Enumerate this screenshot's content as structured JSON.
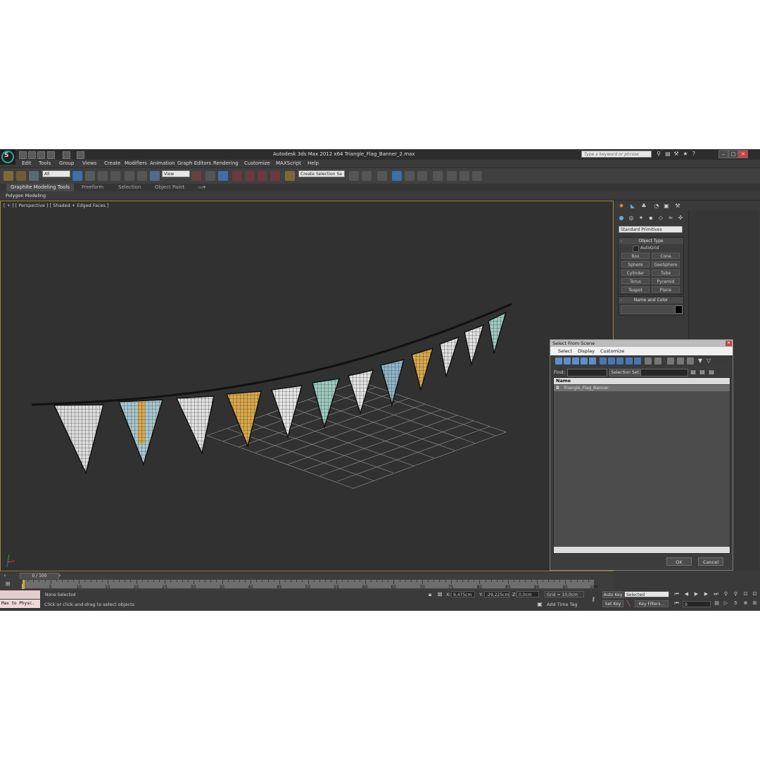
{
  "window": {
    "title": "Autodesk 3ds Max  2012 x64      Triangle_Flag_Banner_2.max",
    "search_placeholder": "Type a keyword or phrase"
  },
  "menu": [
    "Edit",
    "Tools",
    "Group",
    "Views",
    "Create",
    "Modifiers",
    "Animation",
    "Graph Editors",
    "Rendering",
    "Customize",
    "MAXScript",
    "Help"
  ],
  "toolbar": {
    "filter_value": "All",
    "ref_coord_value": "View",
    "named_selection_value": "Create Selection Se"
  },
  "ribbon": {
    "tabs": [
      "Graphite Modeling Tools",
      "Freeform",
      "Selection",
      "Object Paint"
    ],
    "subtab": "Polygon Modeling"
  },
  "viewport": {
    "label": "[ + ] [ Perspective ] [ Shaded + Edged Faces ]"
  },
  "command_panel": {
    "category": "Standard Primitives",
    "object_type_title": "Object Type",
    "autogrid_label": "AutoGrid",
    "primitives": [
      "Box",
      "Cone",
      "Sphere",
      "GeoSphere",
      "Cylinder",
      "Tube",
      "Torus",
      "Pyramid",
      "Teapot",
      "Plane"
    ],
    "name_color_title": "Name and Color"
  },
  "dialog": {
    "title": "Select From Scene",
    "menu": [
      "Select",
      "Display",
      "Customize"
    ],
    "find_label": "Find:",
    "selection_set_label": "Selection Set:",
    "column_name": "Name",
    "objects": [
      "Triangle_Flag_Banner"
    ],
    "ok_label": "OK",
    "cancel_label": "Cancel"
  },
  "timeline": {
    "frame_display": "0 / 100",
    "ticks": [
      "5",
      "10",
      "15",
      "20",
      "25",
      "30",
      "35",
      "40",
      "45",
      "50",
      "55",
      "60",
      "65",
      "70",
      "75",
      "80",
      "85",
      "90",
      "95",
      "100"
    ]
  },
  "status": {
    "maxscript_text": "Max to Physc.",
    "selection": "None Selected",
    "prompt": "Click or click-and-drag to select objects",
    "x_label": "X:",
    "x_value": "9,475cm",
    "y_label": "Y:",
    "y_value": "-29,225cm",
    "z_label": "Z:",
    "z_value": "0,0cm",
    "grid": "Grid = 10,0cm",
    "add_time_tag": "Add Time Tag",
    "auto_key": "Auto Key",
    "set_key": "Set Key",
    "selected_value": "Selected",
    "key_filters": "Key Filters...",
    "frame_value": "0"
  },
  "colors": {
    "flag_orange": "#d9a94a",
    "flag_blue": "#8fb5c8",
    "flag_teal": "#9ccbc0",
    "flag_white": "#e6e6e6",
    "viewport_bg": "#313131",
    "active_border": "#a38a3c"
  }
}
